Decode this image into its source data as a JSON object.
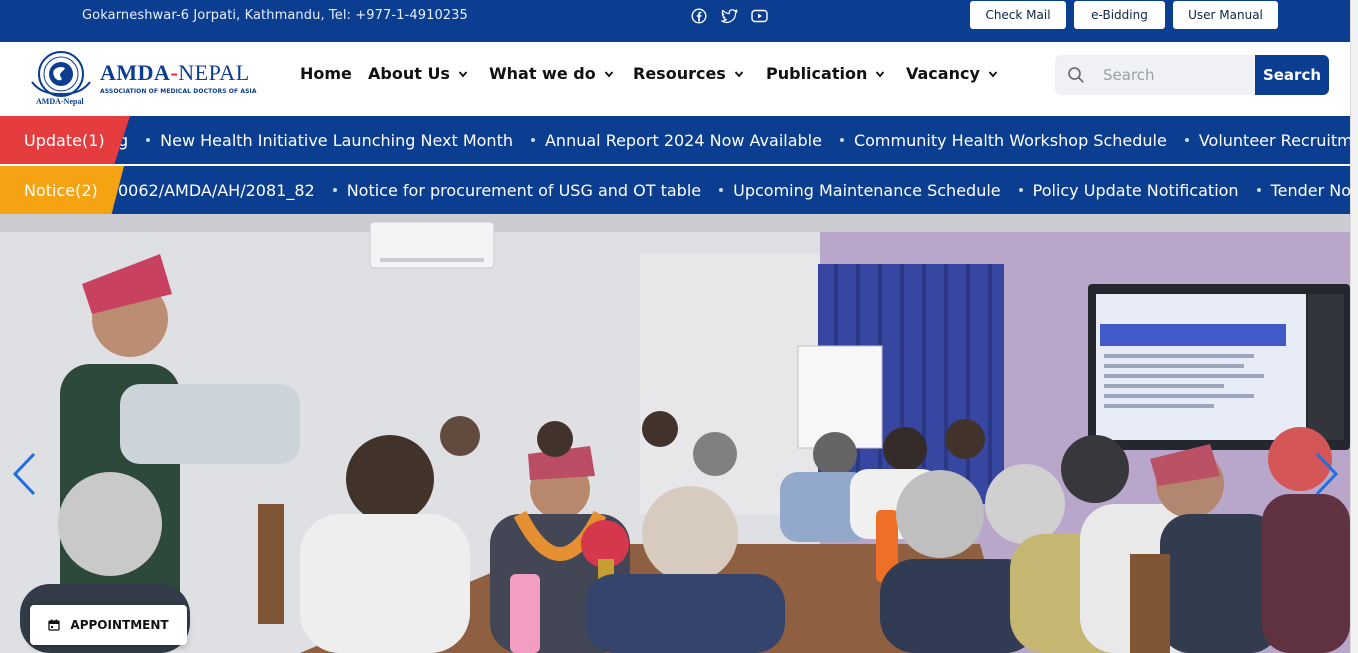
{
  "topbar": {
    "address": "Gokarneshwar-6 Jorpati, Kathmandu, Tel: +977-1-4910235",
    "social_icons": [
      "facebook-icon",
      "twitter-icon",
      "youtube-icon"
    ],
    "buttons": {
      "check_mail": "Check Mail",
      "e_bidding": "e-Bidding",
      "user_manual": "User Manual"
    }
  },
  "logo": {
    "brand_main": "AMDA",
    "brand_dash": "-",
    "brand_country": "NEPAL",
    "subtitle": "ASSOCIATION OF MEDICAL DOCTORS OF ASIA",
    "seal_text": "AMDA-Nepal"
  },
  "nav": {
    "items": [
      {
        "label": "Home",
        "has_dropdown": false
      },
      {
        "label": "About Us",
        "has_dropdown": true
      },
      {
        "label": "What we do",
        "has_dropdown": true
      },
      {
        "label": "Resources",
        "has_dropdown": true
      },
      {
        "label": "Publication",
        "has_dropdown": true
      },
      {
        "label": "Vacancy",
        "has_dropdown": true
      }
    ]
  },
  "search": {
    "placeholder": "Search",
    "button_label": "Search"
  },
  "updates": {
    "label": "Update(1)",
    "lead_fragment": "g",
    "items": [
      "New Health Initiative Launching Next Month",
      "Annual Report 2024 Now Available",
      "Community Health Workshop Schedule",
      "Volunteer Recruitment"
    ]
  },
  "notices": {
    "label": "Notice(2)",
    "lead_fragment": "0062/AMDA/AH/2081_82",
    "items": [
      "Notice for procurement of USG and OT table",
      "Upcoming Maintenance Schedule",
      "Policy Update Notification",
      "Tender Not"
    ]
  },
  "hero": {
    "prev_label": "previous-slide",
    "next_label": "next-slide"
  },
  "appointment": {
    "label": "APPOINTMENT"
  },
  "colors": {
    "brand_blue": "#0b3d91",
    "update_red": "#e53d3f",
    "notice_orange": "#f5a312"
  }
}
